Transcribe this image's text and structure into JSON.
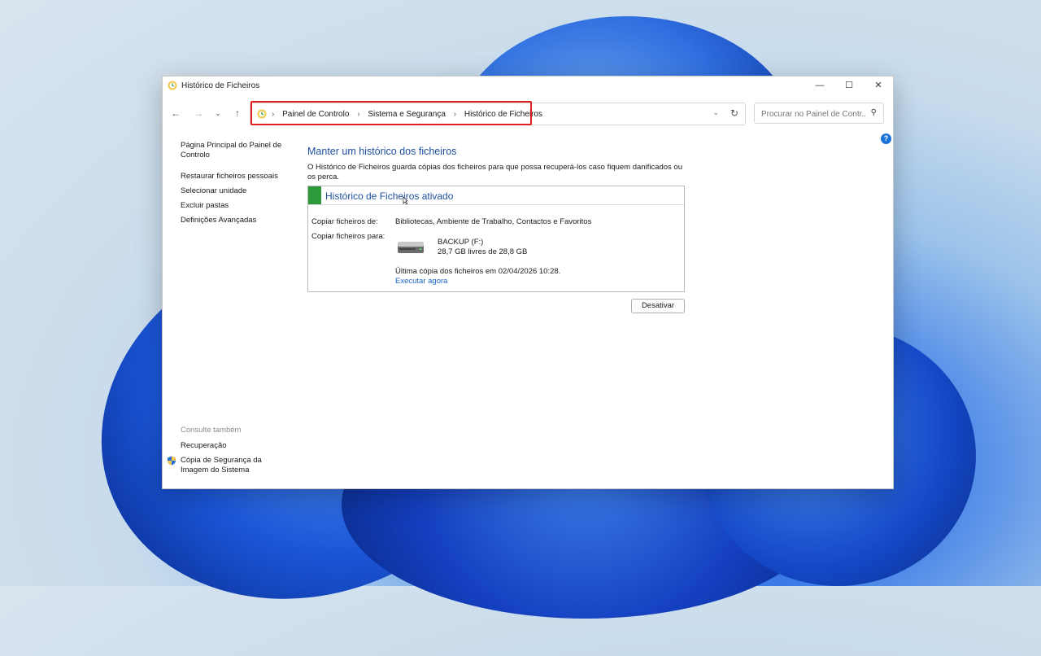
{
  "window": {
    "title": "Histórico de Ficheiros",
    "controls": {
      "minimize": "—",
      "maximize": "☐",
      "close": "✕"
    }
  },
  "navigation": {
    "back": "←",
    "forward": "→",
    "recent": "⌄",
    "up": "↑",
    "breadcrumbs": [
      "Painel de Controlo",
      "Sistema e Segurança",
      "Histórico de Ficheiros"
    ],
    "separator": "›",
    "dropdown": "⌄",
    "refresh": "↻",
    "search_placeholder": "Procurar no Painel de Contr...",
    "search_icon": "⚲"
  },
  "sidebar": {
    "home": "Página Principal do Painel de Controlo",
    "links": [
      "Restaurar ficheiros pessoais",
      "Selecionar unidade",
      "Excluir pastas",
      "Definições Avançadas"
    ],
    "see_also_label": "Consulte também",
    "see_also": [
      "Recuperação",
      "Cópia de Segurança da Imagem do Sistema"
    ]
  },
  "main": {
    "heading": "Manter um histórico dos ficheiros",
    "description": "O Histórico de Ficheiros guarda cópias dos ficheiros para que possa recuperá-los caso fiquem danificados ou os perca.",
    "status": {
      "title": "Histórico de Ficheiros ativado",
      "color": "#2d9a3a",
      "copy_from_label": "Copiar ficheiros de:",
      "copy_from_value": "Bibliotecas, Ambiente de Trabalho, Contactos e Favoritos",
      "copy_to_label": "Copiar ficheiros para:",
      "drive_name": "BACKUP (F:)",
      "drive_space": "28,7 GB livres de 28,8 GB",
      "last_copy": "Última cópia dos ficheiros em 02/04/2026 10:28.",
      "run_now": "Executar agora"
    },
    "disable_button": "Desativar"
  },
  "help_icon": "?"
}
